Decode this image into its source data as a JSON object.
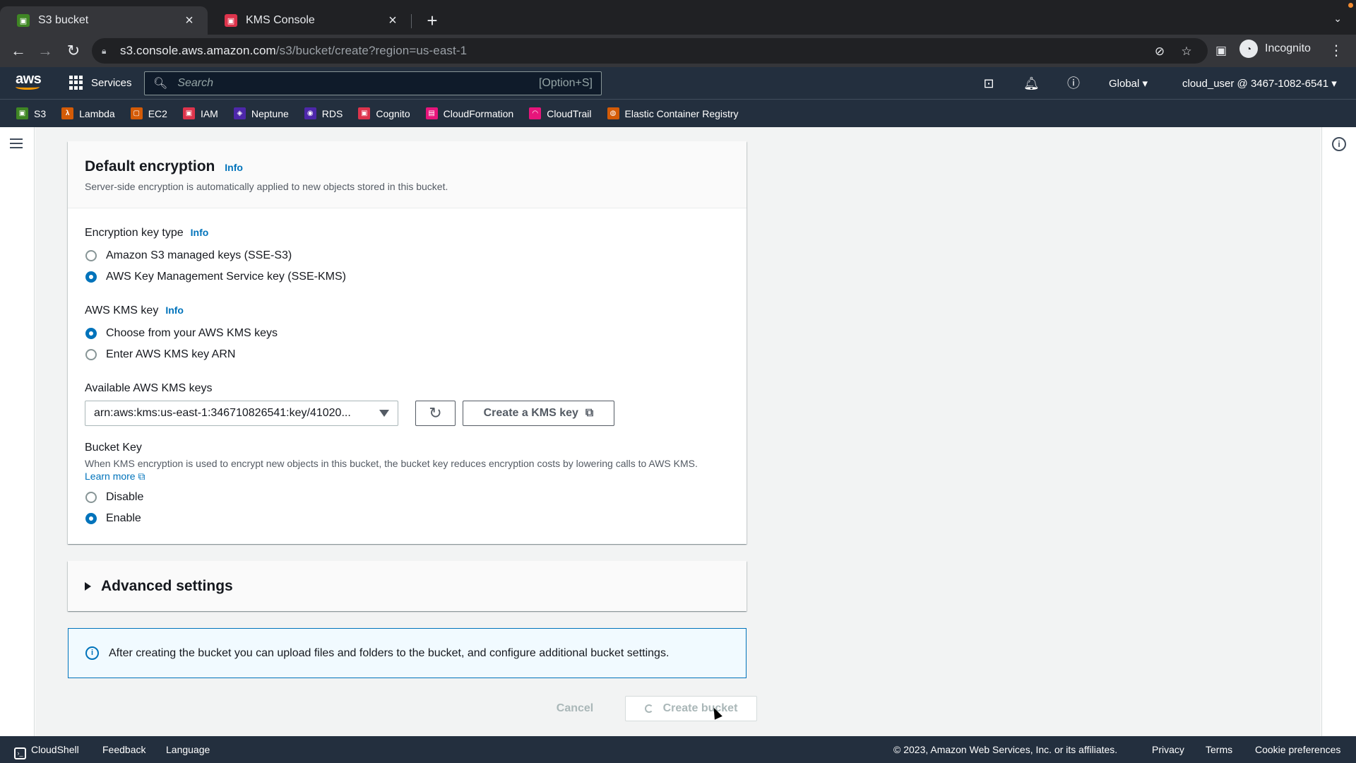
{
  "browser": {
    "tabs": [
      {
        "title": "S3 bucket",
        "active": true,
        "icon": "s3-favicon",
        "color": "#3f8624"
      },
      {
        "title": "KMS Console",
        "active": false,
        "icon": "kms-favicon",
        "color": "#dd344c"
      }
    ],
    "url_host": "s3.console.aws.amazon.com",
    "url_path": "/s3/bucket/create?region=us-east-1",
    "profile_label": "Incognito"
  },
  "aws_header": {
    "logo": "aws",
    "services_label": "Services",
    "search_placeholder": "Search",
    "search_shortcut": "[Option+S]",
    "region": "Global",
    "account": "cloud_user @ 3467-1082-6541"
  },
  "favorites": [
    {
      "label": "S3",
      "color": "#3f8624",
      "glyph": "S3"
    },
    {
      "label": "Lambda",
      "color": "#d45b07",
      "glyph": "λ"
    },
    {
      "label": "EC2",
      "color": "#d45b07",
      "glyph": "E"
    },
    {
      "label": "IAM",
      "color": "#dd344c",
      "glyph": "I"
    },
    {
      "label": "Neptune",
      "color": "#4d27aa",
      "glyph": "N"
    },
    {
      "label": "RDS",
      "color": "#4d27aa",
      "glyph": "R"
    },
    {
      "label": "Cognito",
      "color": "#dd344c",
      "glyph": "C"
    },
    {
      "label": "CloudFormation",
      "color": "#e7157b",
      "glyph": "C"
    },
    {
      "label": "CloudTrail",
      "color": "#e7157b",
      "glyph": "C"
    },
    {
      "label": "Elastic Container Registry",
      "color": "#d45b07",
      "glyph": "E"
    }
  ],
  "encryption": {
    "title": "Default encryption",
    "info": "Info",
    "description": "Server-side encryption is automatically applied to new objects stored in this bucket.",
    "key_type_label": "Encryption key type",
    "key_type_info": "Info",
    "key_type_options": [
      {
        "label": "Amazon S3 managed keys (SSE-S3)",
        "checked": false
      },
      {
        "label": "AWS Key Management Service key (SSE-KMS)",
        "checked": true
      }
    ],
    "kms_key_label": "AWS KMS key",
    "kms_key_info": "Info",
    "kms_key_options": [
      {
        "label": "Choose from your AWS KMS keys",
        "checked": true
      },
      {
        "label": "Enter AWS KMS key ARN",
        "checked": false
      }
    ],
    "available_keys_label": "Available AWS KMS keys",
    "selected_key": "arn:aws:kms:us-east-1:346710826541:key/41020...",
    "create_kms_key_label": "Create a KMS key",
    "bucket_key_label": "Bucket Key",
    "bucket_key_description": "When KMS encryption is used to encrypt new objects in this bucket, the bucket key reduces encryption costs by lowering calls to AWS KMS.",
    "learn_more": "Learn more",
    "bucket_key_options": [
      {
        "label": "Disable",
        "checked": false
      },
      {
        "label": "Enable",
        "checked": true
      }
    ]
  },
  "advanced_settings_label": "Advanced settings",
  "alert_text": "After creating the bucket you can upload files and folders to the bucket, and configure additional bucket settings.",
  "actions": {
    "cancel": "Cancel",
    "create": "Create bucket"
  },
  "footer": {
    "cloudshell": "CloudShell",
    "feedback": "Feedback",
    "language": "Language",
    "copyright": "© 2023, Amazon Web Services, Inc. or its affiliates.",
    "privacy": "Privacy",
    "terms": "Terms",
    "cookies": "Cookie preferences"
  },
  "colors": {
    "aws_navy": "#232f3e",
    "link_blue": "#0073bb",
    "aws_orange": "#ff9900"
  }
}
